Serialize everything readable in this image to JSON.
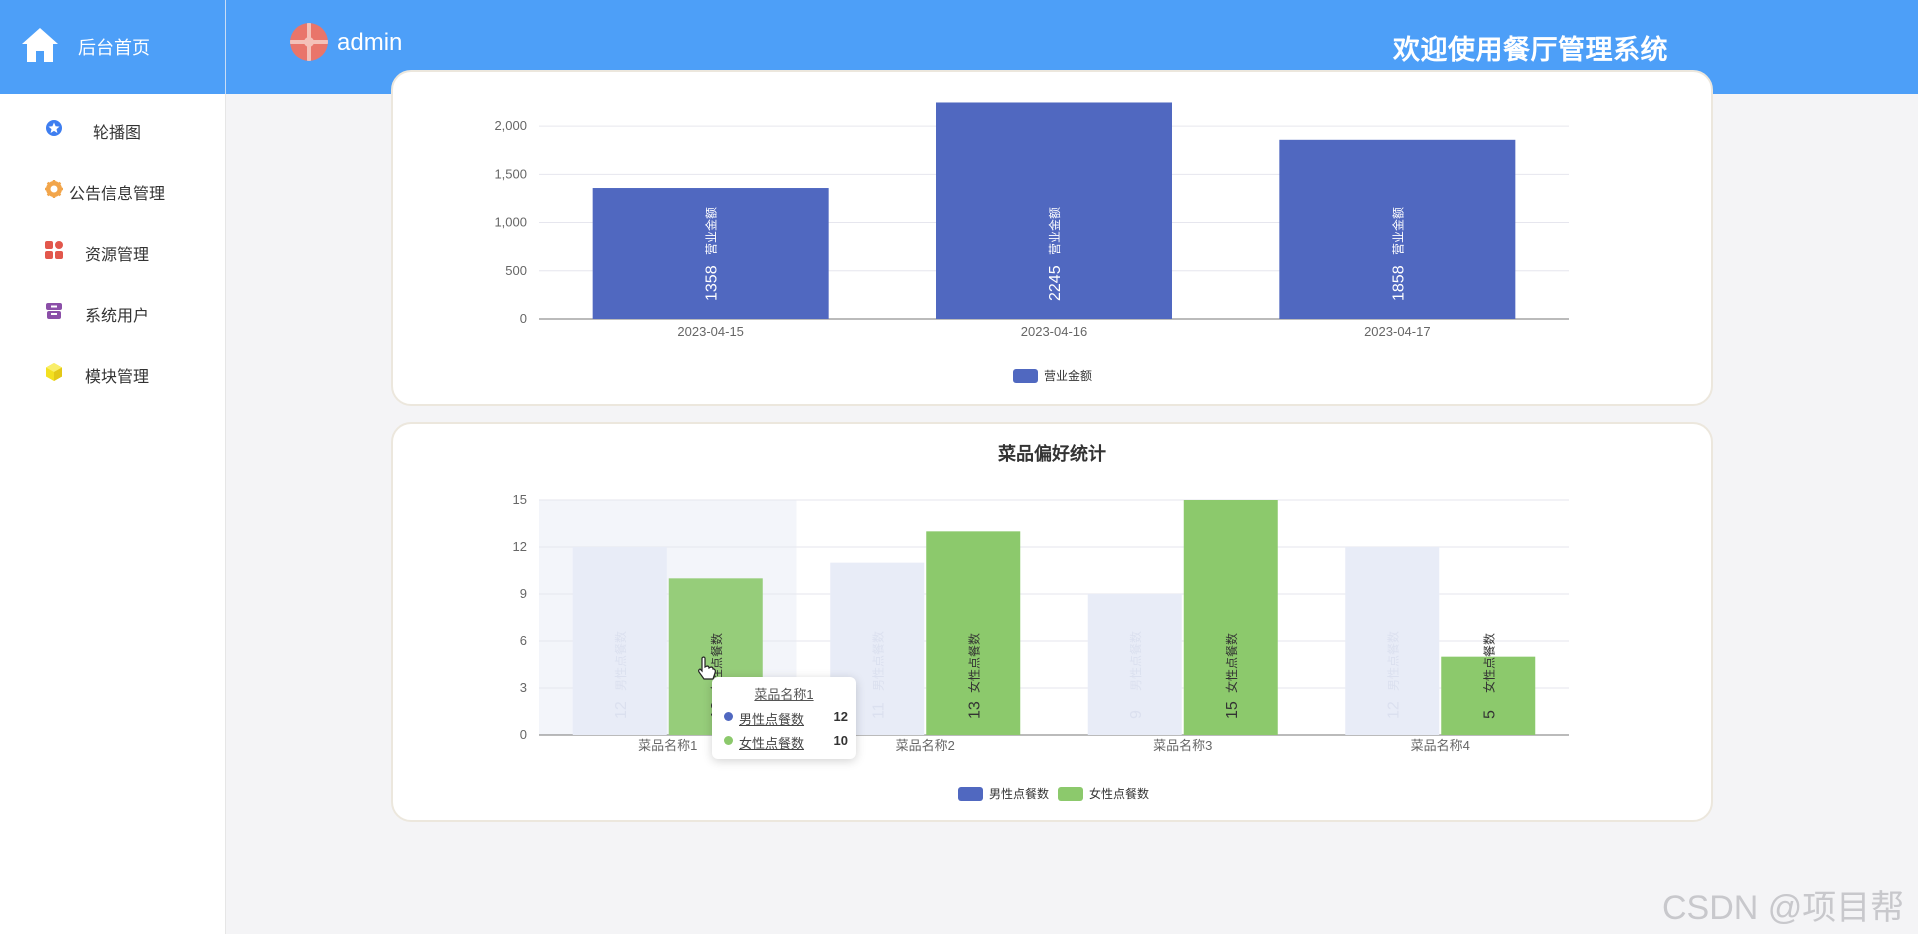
{
  "header": {
    "home_label": "后台首页",
    "username": "admin",
    "welcome": "欢迎使用餐厅管理系统"
  },
  "sidebar": {
    "items": [
      {
        "label": "轮播图",
        "icon": "star-badge-icon"
      },
      {
        "label": "公告信息管理",
        "icon": "gear-badge-icon"
      },
      {
        "label": "资源管理",
        "icon": "grid-icon"
      },
      {
        "label": "系统用户",
        "icon": "archive-icon"
      },
      {
        "label": "模块管理",
        "icon": "cube-icon"
      }
    ]
  },
  "colors": {
    "header": "#4d9ff8",
    "bar_blue": "#5068c0",
    "bar_green": "#8cc96c"
  },
  "chart_data": [
    {
      "type": "bar",
      "title": "",
      "categories": [
        "2023-04-15",
        "2023-04-16",
        "2023-04-17"
      ],
      "series": [
        {
          "name": "营业金额",
          "values": [
            1358,
            2245,
            1858
          ]
        }
      ],
      "ylim": [
        0,
        2250
      ],
      "yticks": [
        "0",
        "500",
        "1,000",
        "1,500",
        "2,000"
      ],
      "grid": true,
      "legend": "bottom-center"
    },
    {
      "type": "bar",
      "title": "菜品偏好统计",
      "categories": [
        "菜品名称1",
        "菜品名称2",
        "菜品名称3",
        "菜品名称4"
      ],
      "series": [
        {
          "name": "男性点餐数",
          "values": [
            12,
            11,
            9,
            12
          ]
        },
        {
          "name": "女性点餐数",
          "values": [
            10,
            13,
            15,
            5
          ]
        }
      ],
      "ylim": [
        0,
        15
      ],
      "yticks": [
        "0",
        "3",
        "6",
        "9",
        "12",
        "15"
      ],
      "grid": true,
      "legend": "bottom-center"
    }
  ],
  "tooltip": {
    "title": "菜品名称1",
    "rows": [
      {
        "name": "男性点餐数",
        "value": "12"
      },
      {
        "name": "女性点餐数",
        "value": "10"
      }
    ]
  },
  "watermark": "CSDN @项目帮"
}
